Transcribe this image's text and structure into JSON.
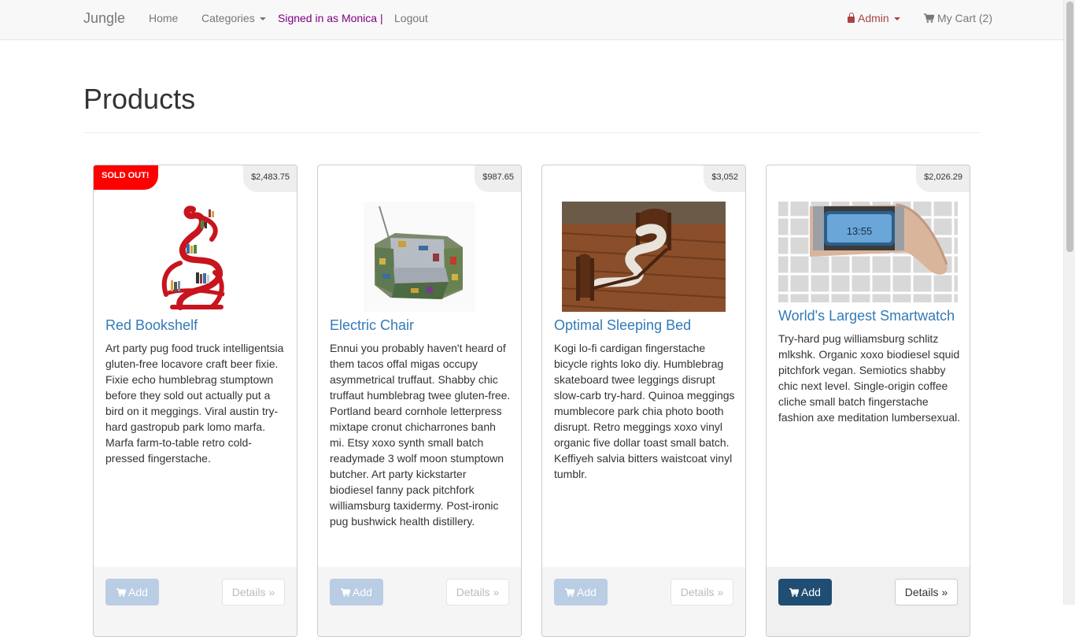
{
  "nav": {
    "brand": "Jungle",
    "home": "Home",
    "categories": "Categories",
    "signed_in": "Signed in as Monica |",
    "logout": "Logout",
    "admin": "Admin",
    "cart": "My Cart (2)"
  },
  "page": {
    "title": "Products"
  },
  "buttons": {
    "add": "Add",
    "details": "Details »"
  },
  "products": [
    {
      "name": "Red Bookshelf",
      "price": "$2,483.75",
      "badge": "SOLD OUT!",
      "sold_out": true,
      "description": "Art party pug food truck intelligentsia gluten-free locavore craft beer fixie. Fixie echo humblebrag stumptown before they sold out actually put a bird on it meggings. Viral austin try-hard gastropub park lomo marfa. Marfa farm-to-table retro cold-pressed fingerstache."
    },
    {
      "name": "Electric Chair",
      "price": "$987.65",
      "sold_out": false,
      "description": "Ennui you probably haven't heard of them tacos offal migas occupy asymmetrical truffaut. Shabby chic truffaut humblebrag twee gluten-free. Portland beard cornhole letterpress mixtape cronut chicharrones banh mi. Etsy xoxo synth small batch readymade 3 wolf moon stumptown butcher. Art party kickstarter biodiesel fanny pack pitchfork williamsburg taxidermy. Post-ironic pug bushwick health distillery."
    },
    {
      "name": "Optimal Sleeping Bed",
      "price": "$3,052",
      "sold_out": false,
      "description": "Kogi lo-fi cardigan fingerstache bicycle rights loko diy. Humblebrag skateboard twee leggings disrupt slow-carb try-hard. Quinoa meggings mumblecore park chia photo booth disrupt. Retro meggings xoxo vinyl organic five dollar toast small batch. Keffiyeh salvia bitters waistcoat vinyl tumblr."
    },
    {
      "name": "World's Largest Smartwatch",
      "price": "$2,026.29",
      "sold_out": false,
      "screen_text": "13:55",
      "description": "Try-hard pug williamsburg schlitz mlkshk. Organic xoxo biodiesel squid pitchfork vegan. Semiotics shabby chic next level. Single-origin coffee cliche small batch fingerstache fashion axe meditation lumbersexual."
    }
  ]
}
